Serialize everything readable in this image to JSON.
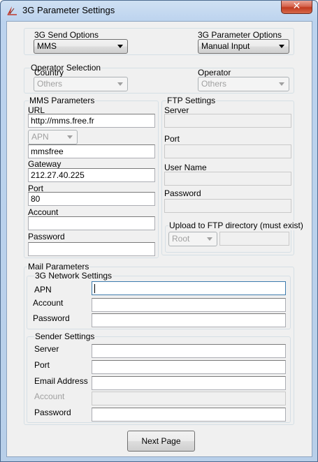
{
  "window": {
    "title": "3G Parameter Settings",
    "close_glyph": "✕"
  },
  "send_options": {
    "label": "3G Send Options",
    "value": "MMS"
  },
  "param_options": {
    "label": "3G Parameter Options",
    "value": "Manual Input"
  },
  "operator_selection": {
    "legend": "Operator Selection",
    "country_label": "Country",
    "country_value": "Others",
    "operator_label": "Operator",
    "operator_value": "Others"
  },
  "mms": {
    "legend": "MMS Parameters",
    "url_label": "URL",
    "url_value": "http://mms.free.fr",
    "apn_select": "APN",
    "apn_value": "mmsfree",
    "gateway_label": "Gateway",
    "gateway_value": "212.27.40.225",
    "port_label": "Port",
    "port_value": "80",
    "account_label": "Account",
    "account_value": "",
    "password_label": "Password",
    "password_value": ""
  },
  "ftp": {
    "legend": "FTP Settings",
    "server_label": "Server",
    "port_label": "Port",
    "username_label": "User Name",
    "password_label": "Password",
    "upload_legend": "Upload to FTP directory (must exist)",
    "dir_select": "Root",
    "dir_value": ""
  },
  "mail": {
    "legend": "Mail Parameters",
    "network": {
      "legend": "3G Network Settings",
      "apn_label": "APN",
      "account_label": "Account",
      "password_label": "Password"
    },
    "sender": {
      "legend": "Sender Settings",
      "server_label": "Server",
      "port_label": "Port",
      "email_label": "Email Address",
      "account_label": "Account",
      "password_label": "Password"
    }
  },
  "next_button": "Next Page",
  "colors": {
    "title_gradient_top": "#cfe0f3",
    "close_red": "#c13a1f",
    "client_bg": "#f0f0f0",
    "disabled_text": "#a0a0a0"
  }
}
